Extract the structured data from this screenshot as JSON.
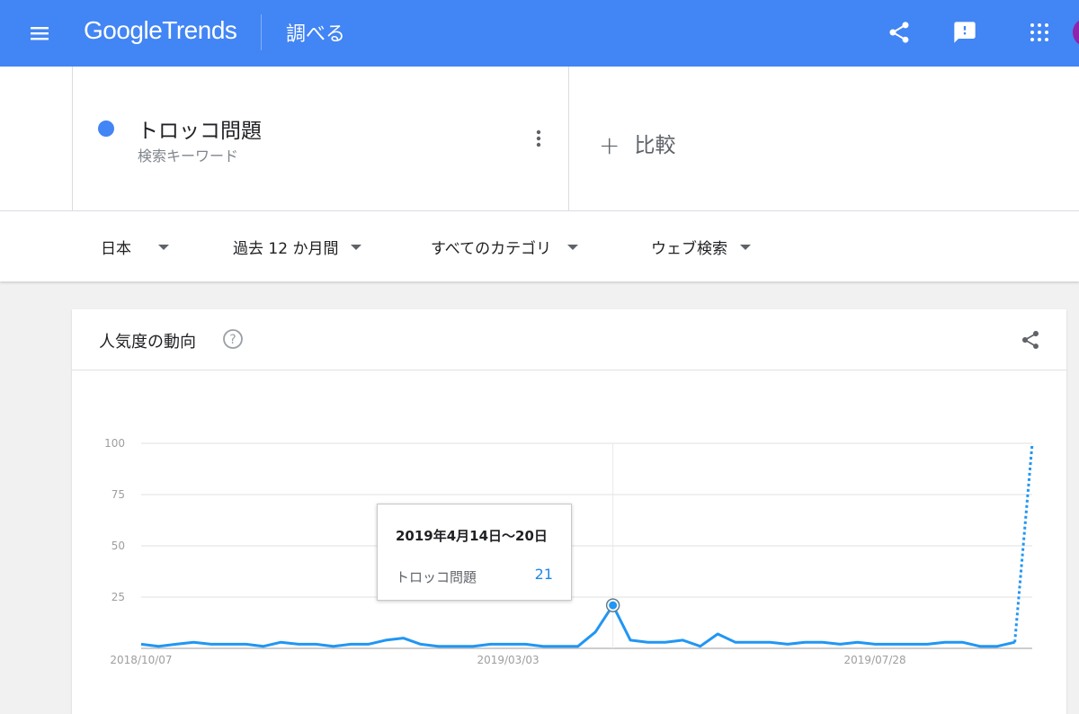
{
  "header": {
    "logo_google": "Google",
    "logo_trends": "Trends",
    "page_title": "調べる",
    "menu_icon": "hamburger-menu-icon",
    "share_icon": "share-icon",
    "feedback_icon": "feedback-icon",
    "apps_icon": "apps-grid-icon",
    "brand_color": "#4285f4"
  },
  "term": {
    "name": "トロッコ問題",
    "type": "検索キーワード",
    "dot_color": "#4285f4"
  },
  "compare": {
    "plus": "+",
    "label": "比較"
  },
  "filters": [
    {
      "label": "日本"
    },
    {
      "label": "過去 12 か月間"
    },
    {
      "label": "すべてのカテゴリ"
    },
    {
      "label": "ウェブ検索"
    }
  ],
  "card": {
    "title": "人気度の動向"
  },
  "tooltip": {
    "date": "2019年4月14日〜20日",
    "term": "トロッコ問題",
    "value": "21"
  },
  "chart_data": {
    "type": "line",
    "y_ticks": [
      "100",
      "75",
      "50",
      "25"
    ],
    "x_ticks": [
      {
        "label": "2018/10/07",
        "index": 0
      },
      {
        "label": "2019/03/03",
        "index": 21
      },
      {
        "label": "2019/07/28",
        "index": 42
      }
    ],
    "ylim": [
      0,
      100
    ],
    "grid": true,
    "series": [
      {
        "color": "#2196f3",
        "values": [
          2,
          1,
          2,
          3,
          2,
          2,
          2,
          1,
          3,
          2,
          2,
          1,
          2,
          2,
          4,
          5,
          2,
          1,
          1,
          1,
          2,
          2,
          2,
          1,
          1,
          1,
          8,
          21,
          4,
          3,
          3,
          4,
          1,
          7,
          3,
          3,
          3,
          2,
          3,
          3,
          2,
          3,
          2,
          2,
          2,
          2,
          3,
          3,
          1,
          1,
          3,
          100
        ],
        "dotted_from_index": 50
      }
    ],
    "highlight_index": 27
  }
}
